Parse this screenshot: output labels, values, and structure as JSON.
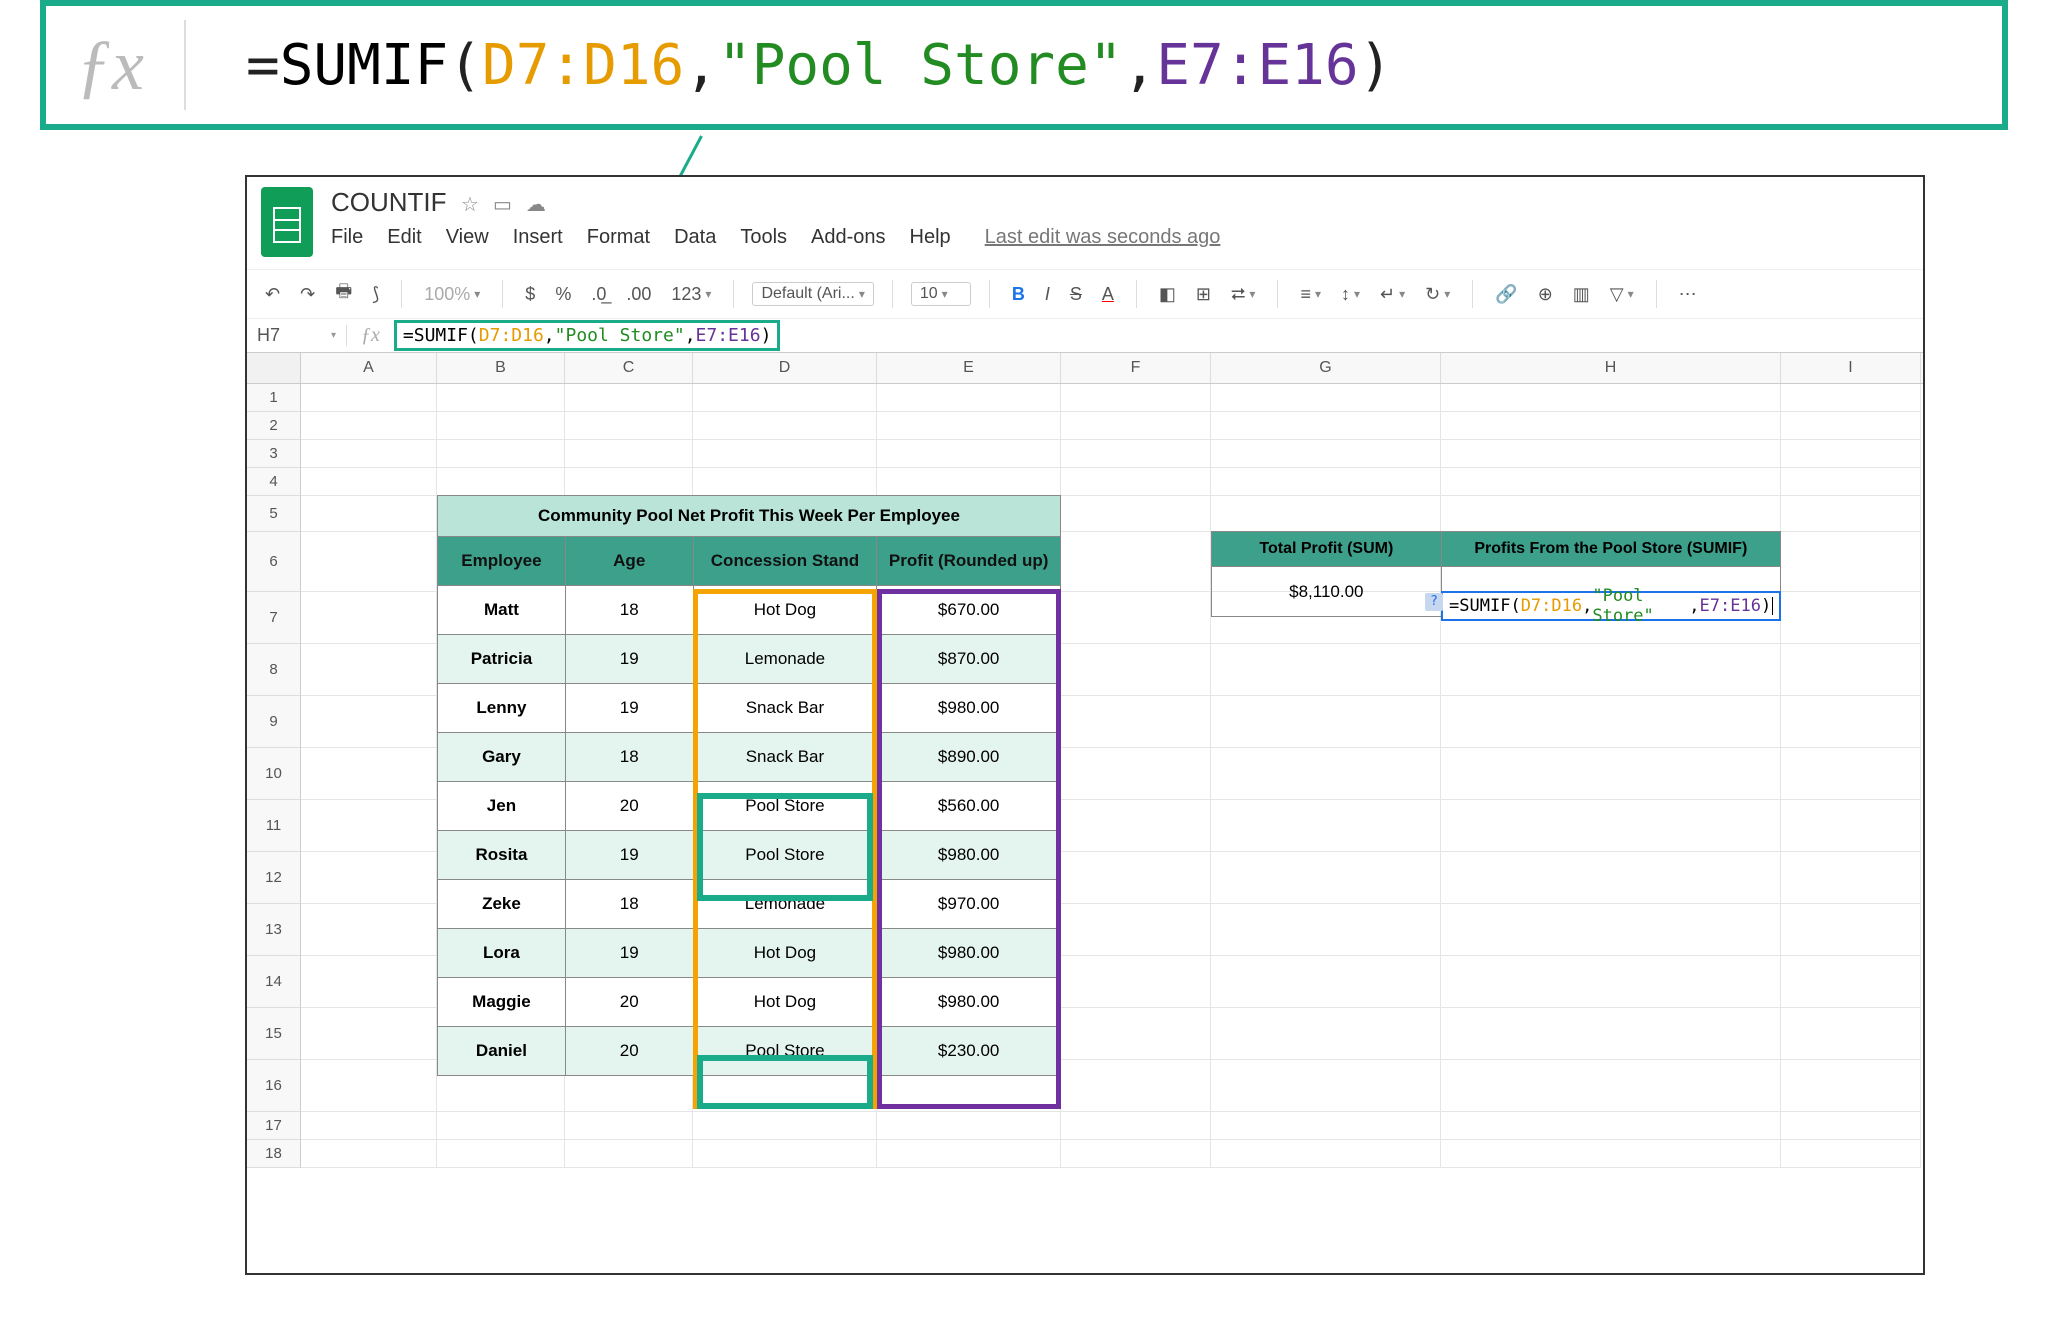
{
  "document": {
    "title": "COUNTIF",
    "last_edit": "Last edit was seconds ago"
  },
  "menus": {
    "file": "File",
    "edit": "Edit",
    "view": "View",
    "insert": "Insert",
    "format": "Format",
    "data": "Data",
    "tools": "Tools",
    "addons": "Add-ons",
    "help": "Help"
  },
  "toolbar": {
    "zoom": "100%",
    "dollar": "$",
    "percent": "%",
    "dec0": ".0",
    "dec00": ".00",
    "num123": "123",
    "font": "Default (Ari...",
    "size": "10",
    "bold": "B",
    "italic": "I",
    "strike": "S",
    "textcolor": "A"
  },
  "fx": {
    "cell_ref": "H7",
    "parts": {
      "eq": "=",
      "fn": "SUMIF",
      "open": "(",
      "r1": "D7:D16",
      "c1": ",",
      "str": "\"Pool Store\"",
      "c2": ",",
      "r2": "E7:E16",
      "close": ")"
    }
  },
  "columns": [
    "A",
    "B",
    "C",
    "D",
    "E",
    "F",
    "G",
    "H",
    "I"
  ],
  "row_nums": [
    "1",
    "2",
    "3",
    "4",
    "5",
    "6",
    "7",
    "8",
    "9",
    "10",
    "11",
    "12",
    "13",
    "14",
    "15",
    "16",
    "17",
    "18"
  ],
  "table": {
    "title": "Community Pool Net Profit This Week Per Employee",
    "headers": {
      "emp": "Employee",
      "age": "Age",
      "conc": "Concession Stand",
      "profit": "Profit (Rounded up)"
    },
    "rows": [
      {
        "emp": "Matt",
        "age": "18",
        "conc": "Hot Dog",
        "profit": "$670.00"
      },
      {
        "emp": "Patricia",
        "age": "19",
        "conc": "Lemonade",
        "profit": "$870.00"
      },
      {
        "emp": "Lenny",
        "age": "19",
        "conc": "Snack Bar",
        "profit": "$980.00"
      },
      {
        "emp": "Gary",
        "age": "18",
        "conc": "Snack Bar",
        "profit": "$890.00"
      },
      {
        "emp": "Jen",
        "age": "20",
        "conc": "Pool Store",
        "profit": "$560.00"
      },
      {
        "emp": "Rosita",
        "age": "19",
        "conc": "Pool Store",
        "profit": "$980.00"
      },
      {
        "emp": "Zeke",
        "age": "18",
        "conc": "Lemonade",
        "profit": "$970.00"
      },
      {
        "emp": "Lora",
        "age": "19",
        "conc": "Hot Dog",
        "profit": "$980.00"
      },
      {
        "emp": "Maggie",
        "age": "20",
        "conc": "Hot Dog",
        "profit": "$980.00"
      },
      {
        "emp": "Daniel",
        "age": "20",
        "conc": "Pool Store",
        "profit": "$230.00"
      }
    ]
  },
  "summary": {
    "h1": "Total Profit (SUM)",
    "h2": "Profits From the Pool Store (SUMIF)",
    "total": "$8,110.00"
  },
  "row_heights": {
    "short": 28,
    "header6": 60,
    "data": 52
  }
}
